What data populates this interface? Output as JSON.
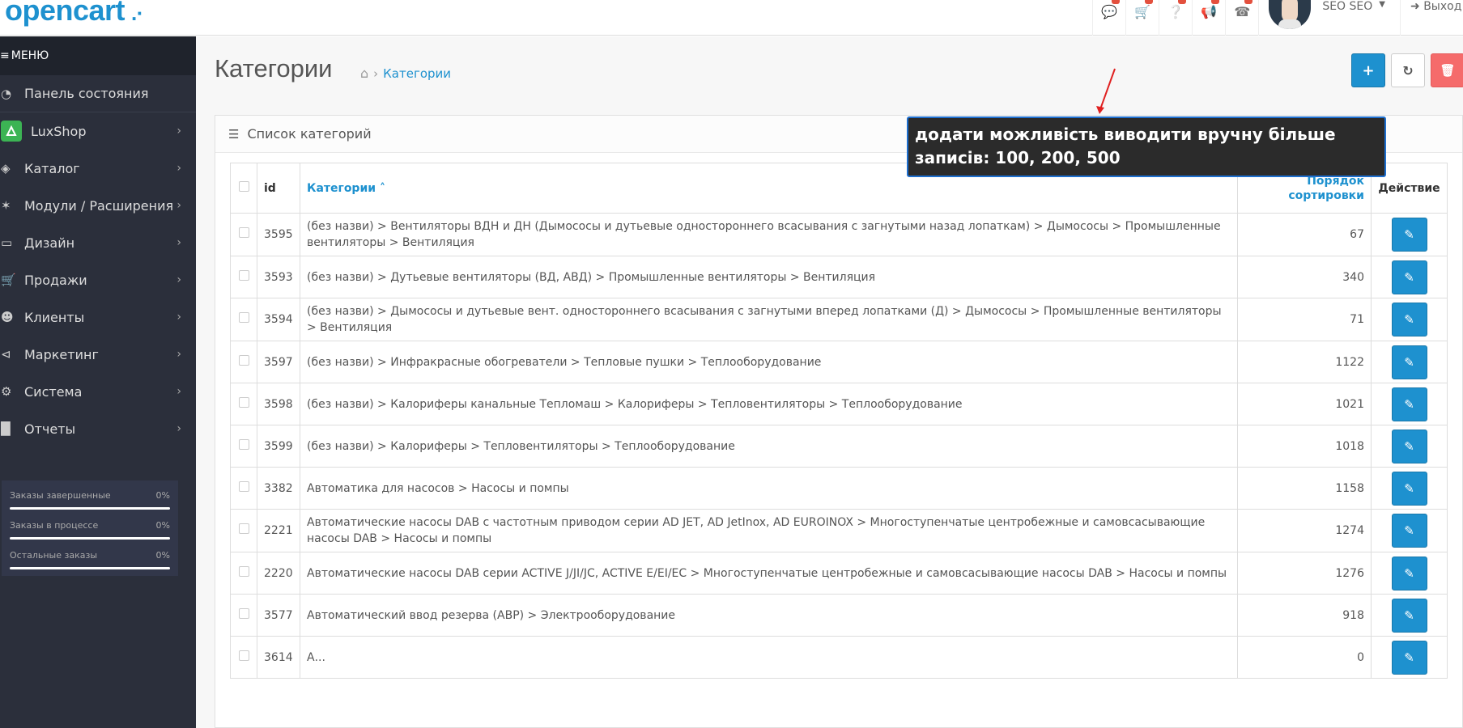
{
  "header": {
    "logo": "opencart",
    "logo_cart": ".·",
    "user_name": "SEO SEO",
    "logout_label": "Выход",
    "icons": [
      "comment-icon",
      "cart-icon",
      "question-icon",
      "bullhorn-icon",
      "phone-icon"
    ]
  },
  "sidebar": {
    "menu_label": "МЕНЮ",
    "items": [
      {
        "label": "Панель состояния",
        "icon": "dashboard-icon"
      },
      {
        "label": "LuxShop",
        "icon": "luxshop-icon"
      },
      {
        "label": "Каталог",
        "icon": "tags-icon"
      },
      {
        "label": "Модули / Расширения",
        "icon": "puzzle-icon"
      },
      {
        "label": "Дизайн",
        "icon": "desktop-icon"
      },
      {
        "label": "Продажи",
        "icon": "shopping-cart-icon"
      },
      {
        "label": "Клиенты",
        "icon": "user-icon"
      },
      {
        "label": "Маркетинг",
        "icon": "share-icon"
      },
      {
        "label": "Система",
        "icon": "cog-icon"
      },
      {
        "label": "Отчеты",
        "icon": "bar-chart-icon"
      }
    ],
    "stats": [
      {
        "label": "Заказы завершенные",
        "value": "0%"
      },
      {
        "label": "Заказы в процессе",
        "value": "0%"
      },
      {
        "label": "Остальные заказы",
        "value": "0%"
      }
    ]
  },
  "page": {
    "title": "Категории",
    "breadcrumb": "Категории",
    "panel_title": "Список категорий"
  },
  "table": {
    "headers": {
      "id": "id",
      "name": "Категории",
      "sort_line1": "Порядок",
      "sort_line2": "сортировки",
      "action": "Действие"
    },
    "rows": [
      {
        "id": "3595",
        "name": "(без назви)  >  Вентиляторы ВДН и ДН (Дымососы и дутьевые одностороннего всасывания с загнутыми назад лопаткам)  >  Дымососы  >  Промышленные вентиляторы  >  Вентиляция",
        "sort": "67"
      },
      {
        "id": "3593",
        "name": "(без назви)  >  Дутьевые вентиляторы (ВД, АВД)  >  Промышленные вентиляторы  >  Вентиляция",
        "sort": "340"
      },
      {
        "id": "3594",
        "name": "(без назви)  >  Дымососы и дутьевые вент. одностороннего всасывания с загнутыми вперед лопатками (Д)  >  Дымососы  >  Промышленные вентиляторы  >  Вентиляция",
        "sort": "71"
      },
      {
        "id": "3597",
        "name": "(без назви)  >  Инфракрасные обогреватели  >  Тепловые пушки  >  Теплооборудование",
        "sort": "1122"
      },
      {
        "id": "3598",
        "name": "(без назви)  >  Калориферы канальные Тепломаш  >  Калориферы  >  Тепловентиляторы  >  Теплооборудование",
        "sort": "1021"
      },
      {
        "id": "3599",
        "name": "(без назви)  >  Калориферы  >  Тепловентиляторы  >  Теплооборудование",
        "sort": "1018"
      },
      {
        "id": "3382",
        "name": "Автоматика для насосов  >  Насосы и помпы",
        "sort": "1158"
      },
      {
        "id": "2221",
        "name": "Автоматические насосы DAB с частотным приводом серии AD JET, AD JetInox, AD EUROINOX  >  Многоступенчатые центробежные и самовсасывающие насосы DAB  >  Насосы и помпы",
        "sort": "1274"
      },
      {
        "id": "2220",
        "name": "Автоматические насосы DAB серии ACTIVE J/JI/JC, ACTIVE E/EI/EC  >  Многоступенчатые центробежные и самовсасывающие насосы DAB  >  Насосы и помпы",
        "sort": "1276"
      },
      {
        "id": "3577",
        "name": "Автоматический ввод резерва (АВР)  >  Электрооборудование",
        "sort": "918"
      },
      {
        "id": "3614",
        "name": "А...",
        "sort": "0"
      }
    ]
  },
  "annotation": {
    "text": "додати можливість виводити вручну більше записів: 100, 200, 500"
  },
  "colors": {
    "accent": "#1e91cf",
    "sidebar": "#2b2f3b",
    "danger": "#f56b6b",
    "annotation_bg": "#2b2b2b",
    "arrow": "#e02020"
  }
}
